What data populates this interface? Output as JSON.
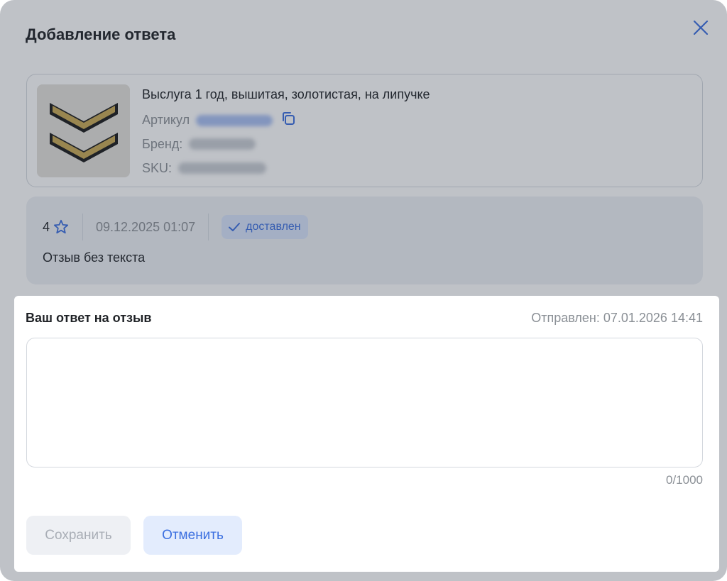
{
  "modal": {
    "title": "Добавление ответа"
  },
  "product": {
    "name": "Выслуга 1 год, вышитая, золотистая, на липучке",
    "article_label": "Артикул",
    "brand_label": "Бренд:",
    "sku_label": "SKU:"
  },
  "review": {
    "rating": "4",
    "date": "09.12.2025 01:07",
    "status": "доставлен",
    "text": "Отзыв без текста"
  },
  "answer": {
    "title": "Ваш ответ на отзыв",
    "sent_info": "Отправлен: 07.01.2026 14:41",
    "value": "",
    "counter": "0/1000",
    "save_label": "Сохранить",
    "cancel_label": "Отменить"
  },
  "colors": {
    "accent": "#3b6fe0",
    "overlay": "rgba(44,52,70,0.30)",
    "badge_bg": "#d9e4fb"
  },
  "icons": [
    "close-icon",
    "copy-icon",
    "star-icon",
    "check-icon"
  ]
}
